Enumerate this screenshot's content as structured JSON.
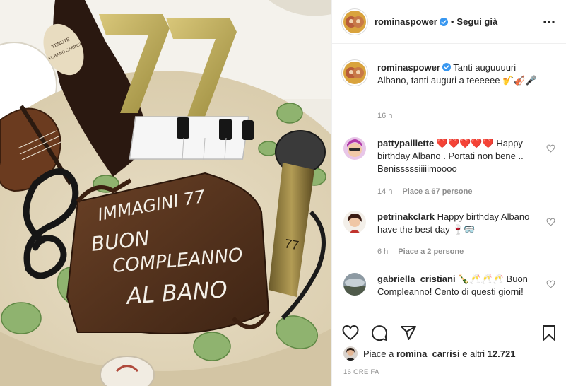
{
  "post": {
    "author": "rominaspower",
    "follow_state": "Segui già",
    "separator": "•",
    "caption": "Tanti auguuuuri Albano, tanti auguri a teeeeee 🎷🎻🎤",
    "caption_time": "16 h",
    "photo": {
      "cake_lettering": [
        "IMMAGINI 77",
        "BUON",
        "COMPLEANNO",
        "AL BANO"
      ],
      "number_topper": "77",
      "bottle_label": "TENUTE AL BANO CARRISI"
    }
  },
  "comments": [
    {
      "username": "pattypaillette",
      "text": "❤️❤️❤️❤️❤️ Happy birthday Albano . Portati non bene .. Benisssssiiiiimoooo",
      "time": "14 h",
      "likes": "Piace a 67 persone"
    },
    {
      "username": "petrinakclark",
      "text": "Happy birthday Albano have the best day 🍷🥽",
      "time": "6 h",
      "likes": "Piace a 2 persone"
    },
    {
      "username": "gabriella_cristiani",
      "text": "🍾🥂🥂🥂 Buon Compleanno! Cento di questi giorni!",
      "time": "",
      "likes": ""
    }
  ],
  "likes_line": {
    "prefix": "Piace a",
    "user": "romina_carrisi",
    "suffix": "e altri",
    "count": "12.721"
  },
  "timestamp": "16 ORE FA",
  "icons": [
    "verified-badge-icon",
    "more-options-icon",
    "heart-icon",
    "comment-icon",
    "share-icon",
    "bookmark-icon"
  ],
  "colors": {
    "verified": "#3897f0",
    "text": "#262626",
    "muted": "#8e8e8e",
    "divider": "#efefef"
  }
}
